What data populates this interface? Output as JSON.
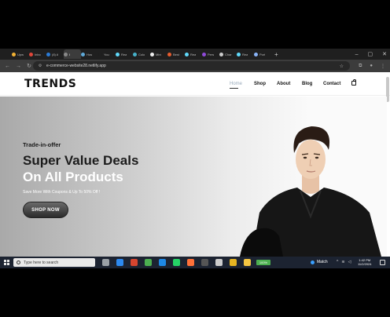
{
  "browser": {
    "tabs": [
      {
        "label": "Upw",
        "color": "#f2b134"
      },
      {
        "label": "Inbo",
        "color": "#e0463a"
      },
      {
        "label": "(8) A",
        "color": "#2b7bd6"
      },
      {
        "label": "I",
        "color": "#888888"
      },
      {
        "label": "Hos",
        "color": "#5fa9d8"
      },
      {
        "label": "You",
        "color": "#1f1f1f"
      },
      {
        "label": "Rea",
        "color": "#61dafb"
      },
      {
        "label": "Colo",
        "color": "#46b1c9"
      },
      {
        "label": "Mini",
        "color": "#eeeeee"
      },
      {
        "label": "Best",
        "color": "#e85d2f"
      },
      {
        "label": "Rea",
        "color": "#61dafb"
      },
      {
        "label": "Pers",
        "color": "#8f4ad8"
      },
      {
        "label": "Char",
        "color": "#cccccc"
      },
      {
        "label": "Rea",
        "color": "#61dafb"
      },
      {
        "label": "Port",
        "color": "#8ab4f8"
      }
    ],
    "active_tab_index": 3,
    "new_tab": "+",
    "url": "e-commerce-website28.netlify.app"
  },
  "site": {
    "logo": "TRENDS",
    "nav": {
      "home": "Home",
      "shop": "Shop",
      "about": "About",
      "blog": "Blog",
      "contact": "Contact"
    }
  },
  "hero": {
    "eyebrow": "Trade-in-offer",
    "title_line1": "Super Value Deals",
    "title_line2": "On All Products",
    "subtitle": "Save More With Coupons & Up To 50% Off !",
    "button": "SHOP NOW"
  },
  "taskbar": {
    "search_placeholder": "Type here to search",
    "battery_label": "100%",
    "weather": "Match",
    "time": "1:42 PM",
    "date": "11/2/2024",
    "icons": [
      {
        "name": "task-view-icon",
        "color": "#9aa0a6"
      },
      {
        "name": "store-icon",
        "color": "#2d89ef"
      },
      {
        "name": "app-icon",
        "color": "#d6452f"
      },
      {
        "name": "chrome-icon",
        "color": "#4caf50"
      },
      {
        "name": "vscode-icon",
        "color": "#1e88e5"
      },
      {
        "name": "whatsapp-icon",
        "color": "#25d366"
      },
      {
        "name": "firefox-icon",
        "color": "#ff7139"
      },
      {
        "name": "terminal-icon",
        "color": "#555555"
      },
      {
        "name": "settings-icon",
        "color": "#cccccc"
      },
      {
        "name": "app2-icon",
        "color": "#e6b422"
      },
      {
        "name": "files-icon",
        "color": "#f4c542"
      }
    ]
  }
}
